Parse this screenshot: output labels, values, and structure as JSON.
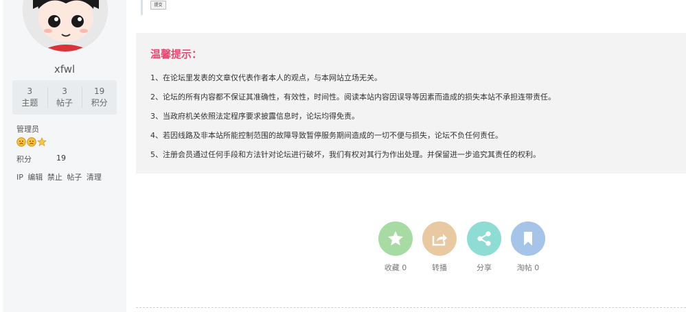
{
  "user": {
    "name": "xfwl",
    "stats": [
      {
        "value": "3",
        "label": "主题"
      },
      {
        "value": "3",
        "label": "帖子"
      },
      {
        "value": "19",
        "label": "积分"
      }
    ],
    "role": "管理员",
    "points_label": "积分",
    "points_value": "19",
    "actions": [
      "IP",
      "编辑",
      "禁止",
      "帖子",
      "清理"
    ]
  },
  "submit_label": "提交",
  "tips": {
    "title": "温馨提示：",
    "items": [
      "1、在论坛里发表的文章仅代表作者本人的观点，与本网站立场无关。",
      "2、论坛的所有内容都不保证其准确性，有效性，时间性。阅读本站内容因误导等因素而造成的损失本站不承担连带责任。",
      "3、当政府机关依照法定程序要求披露信息时，论坛均得免责。",
      "4、若因线路及非本站所能控制范围的故障导致暂停服务期间造成的一切不便与损失，论坛不负任何责任。",
      "5、注册会员通过任何手段和方法针对论坛进行破坏，我们有权对其行为作出处理。并保留进一步追究其责任的权利。"
    ]
  },
  "share_buttons": [
    {
      "label": "收藏 0",
      "icon": "star-icon",
      "color": "#a8dba4"
    },
    {
      "label": "转播",
      "icon": "forward-icon",
      "color": "#e8c9a2"
    },
    {
      "label": "分享",
      "icon": "share-icon",
      "color": "#8fdcd5"
    },
    {
      "label": "淘帖 0",
      "icon": "bookmark-icon",
      "color": "#a5c4e8"
    }
  ],
  "colors": {
    "tips_title": "#e34a72",
    "sidebar_bg": "#f4f6f8",
    "tips_bg": "#f3f3f3"
  }
}
